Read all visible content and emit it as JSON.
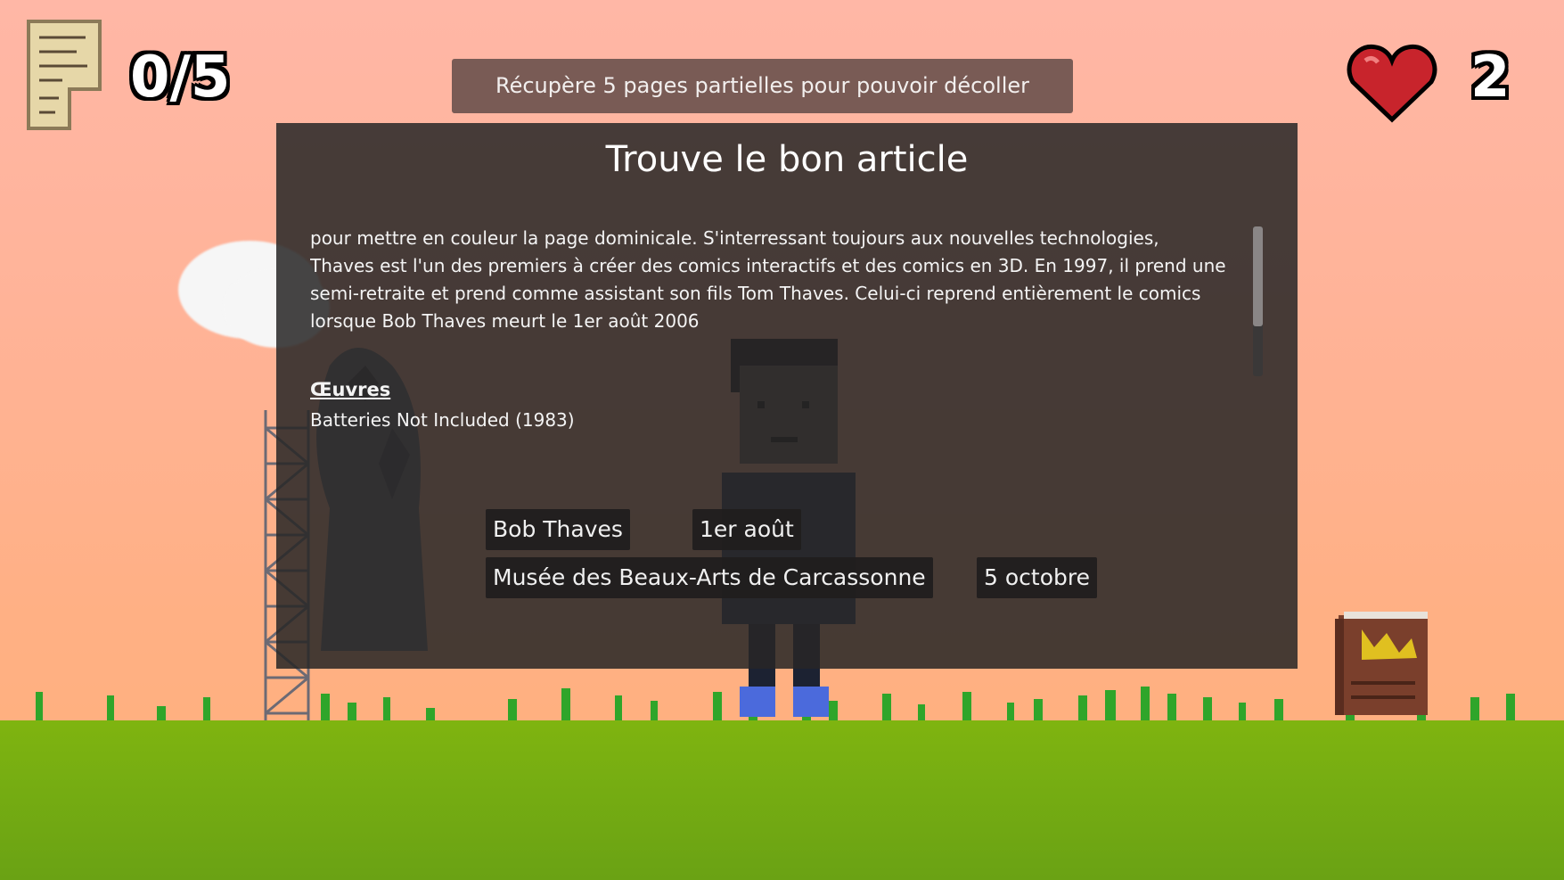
{
  "hud": {
    "pages_count": "0/5",
    "pages_icon": "scroll-page-icon",
    "lives_icon": "heart-icon",
    "lives": "2"
  },
  "objective": "Récupère 5 pages partielles pour pouvoir décoller",
  "panel": {
    "title": "Trouve le bon article",
    "article_text": "pour mettre en couleur la page dominicale. S'interressant toujours aux nouvelles technologies, Thaves est l'un des premiers à créer des comics interactifs et des comics en 3D. En 1997, il prend une semi-retraite et prend comme assistant son fils Tom Thaves. Celui-ci reprend entièrement le comics lorsque Bob Thaves meurt le 1er août 2006",
    "section_heading": "Œuvres",
    "section_item": "Batteries Not Included (1983)",
    "choices": [
      "Bob Thaves",
      "1er août",
      "Musée des Beaux-Arts de Carcassonne",
      "5 octobre"
    ]
  },
  "colors": {
    "sky": "#ffb398",
    "ground": "#76ad12",
    "panel": "#282626",
    "objective_bg": "#6e544e",
    "heart": "#c8242c"
  }
}
